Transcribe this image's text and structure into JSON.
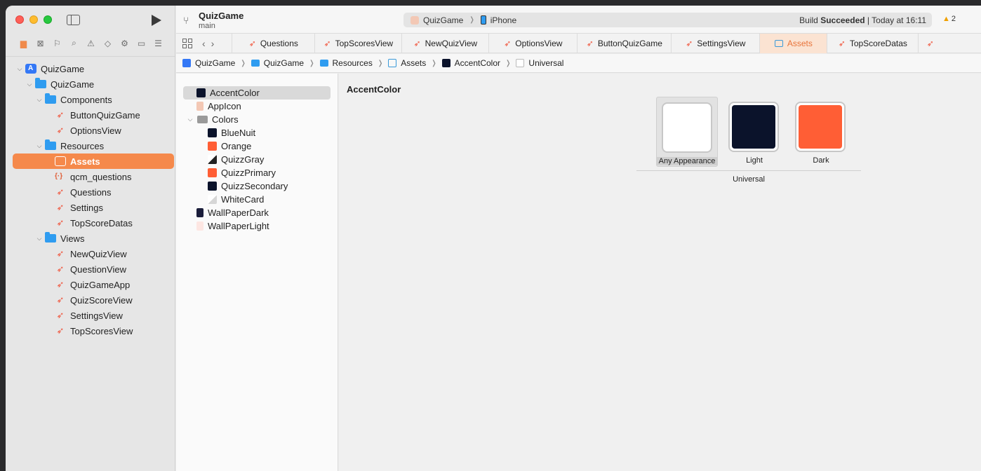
{
  "titlebar": {
    "project": "QuizGame",
    "branch": "main",
    "scheme_app": "QuizGame",
    "scheme_device": "iPhone",
    "build_prefix": "Build",
    "build_status": "Succeeded",
    "build_time": "| Today at 16:11",
    "warnings": "2"
  },
  "navigator": {
    "items": [
      {
        "label": "QuizGame",
        "level": 0,
        "icon": "project-icon",
        "expanded": true
      },
      {
        "label": "QuizGame",
        "level": 1,
        "icon": "folder-icon",
        "expanded": true
      },
      {
        "label": "Components",
        "level": 2,
        "icon": "folder-icon",
        "expanded": true
      },
      {
        "label": "ButtonQuizGame",
        "level": 3,
        "icon": "swift-file-icon"
      },
      {
        "label": "OptionsView",
        "level": 3,
        "icon": "swift-file-icon"
      },
      {
        "label": "Resources",
        "level": 2,
        "icon": "folder-icon",
        "expanded": true
      },
      {
        "label": "Assets",
        "level": 3,
        "icon": "assets-icon",
        "selected": true
      },
      {
        "label": "qcm_questions",
        "level": 3,
        "icon": "json-file-icon"
      },
      {
        "label": "Questions",
        "level": 3,
        "icon": "swift-file-icon"
      },
      {
        "label": "Settings",
        "level": 3,
        "icon": "swift-file-icon"
      },
      {
        "label": "TopScoreDatas",
        "level": 3,
        "icon": "swift-file-icon"
      },
      {
        "label": "Views",
        "level": 2,
        "icon": "folder-icon",
        "expanded": true
      },
      {
        "label": "NewQuizView",
        "level": 3,
        "icon": "swift-file-icon"
      },
      {
        "label": "QuestionView",
        "level": 3,
        "icon": "swift-file-icon"
      },
      {
        "label": "QuizGameApp",
        "level": 3,
        "icon": "swift-file-icon"
      },
      {
        "label": "QuizScoreView",
        "level": 3,
        "icon": "swift-file-icon"
      },
      {
        "label": "SettingsView",
        "level": 3,
        "icon": "swift-file-icon"
      },
      {
        "label": "TopScoresView",
        "level": 3,
        "icon": "swift-file-icon"
      }
    ]
  },
  "tabs": [
    {
      "label": "Questions",
      "icon": "swift"
    },
    {
      "label": "TopScoresView",
      "icon": "swift"
    },
    {
      "label": "NewQuizView",
      "icon": "swift"
    },
    {
      "label": "OptionsView",
      "icon": "swift"
    },
    {
      "label": "ButtonQuizGame",
      "icon": "swift"
    },
    {
      "label": "SettingsView",
      "icon": "swift"
    },
    {
      "label": "Assets",
      "icon": "assets",
      "active": true
    },
    {
      "label": "TopScoreDatas",
      "icon": "swift"
    }
  ],
  "path": [
    "QuizGame",
    "QuizGame",
    "Resources",
    "Assets",
    "AccentColor",
    "Universal"
  ],
  "assets": [
    {
      "label": "AccentColor",
      "level": 0,
      "color": "#0b132b",
      "selected": true
    },
    {
      "label": "AppIcon",
      "level": 0,
      "color": "#f3c8b5"
    },
    {
      "label": "Colors",
      "level": 0,
      "folder": true
    },
    {
      "label": "BlueNuit",
      "level": 1,
      "color": "#0b132b"
    },
    {
      "label": "Orange",
      "level": 1,
      "color": "#ff5e35"
    },
    {
      "label": "QuizzGray",
      "level": 1,
      "color": "split"
    },
    {
      "label": "QuizzPrimary",
      "level": 1,
      "color": "#ff5e35"
    },
    {
      "label": "QuizzSecondary",
      "level": 1,
      "color": "#0b132b"
    },
    {
      "label": "WhiteCard",
      "level": 1,
      "color": "split-light"
    },
    {
      "label": "WallPaperDark",
      "level": 0,
      "color": "#1a1d3a"
    },
    {
      "label": "WallPaperLight",
      "level": 0,
      "color": "#fde6e2"
    }
  ],
  "detail": {
    "title": "AccentColor",
    "wells": [
      {
        "label": "Any Appearance",
        "color": "#ffffff",
        "selected": true
      },
      {
        "label": "Light",
        "color": "#0b132b"
      },
      {
        "label": "Dark",
        "color": "#ff5e35"
      }
    ],
    "group_label": "Universal"
  },
  "colors": {
    "accent": "#f5894b",
    "swift": "#f05138",
    "folder": "#2f9cf0"
  }
}
